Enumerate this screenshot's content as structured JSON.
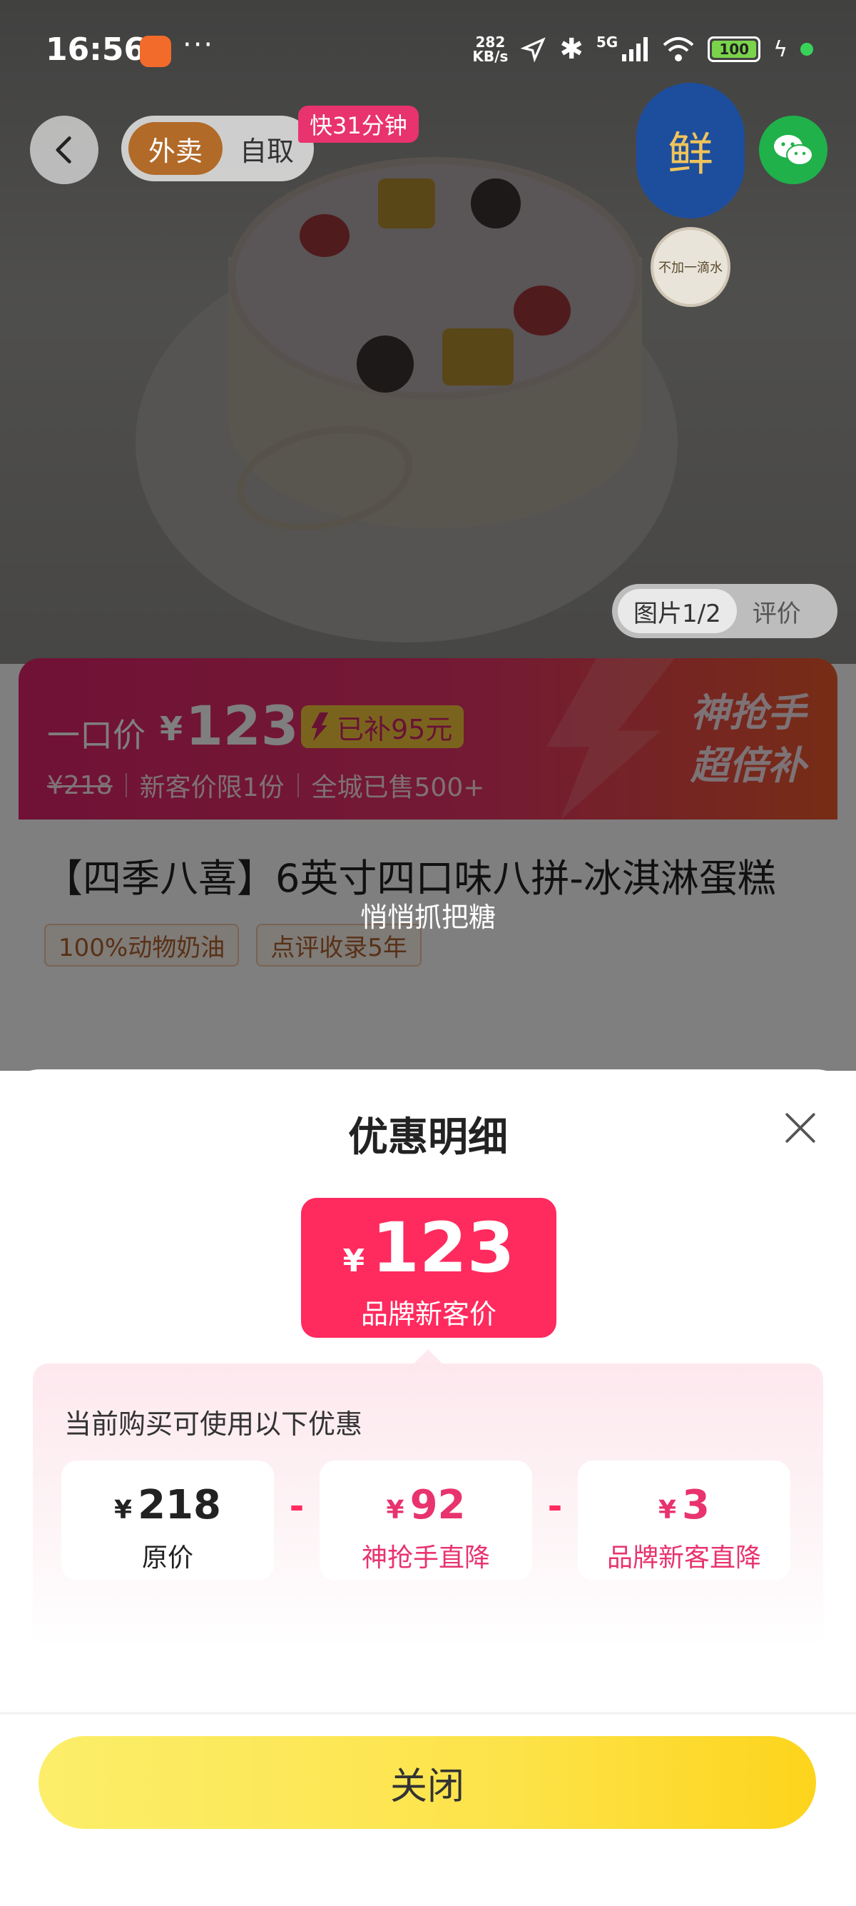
{
  "status_bar": {
    "time": "16:56",
    "more": "···",
    "net_speed_value": "282",
    "net_speed_unit": "KB/s",
    "signal_label": "5G",
    "battery": "100",
    "icons": [
      "navigation-icon",
      "bluetooth-icon",
      "signal-icon",
      "wifi-icon",
      "charging-icon"
    ]
  },
  "nav": {
    "mode_active": "外卖",
    "mode_inactive": "自取",
    "fast_badge": "快31分钟"
  },
  "hero": {
    "fresh_badge": "鲜",
    "no_water_badge": "不加一滴水",
    "image_tab_active": "图片1/2",
    "image_tab_review": "评价"
  },
  "price_banner": {
    "label": "一口价",
    "yen": "¥",
    "price": "123",
    "subsidy": "已补95元",
    "original_price": "¥218",
    "new_customer": "新客价限1份",
    "sold": "全城已售500+",
    "promo_line1": "神抢手",
    "promo_line2": "超倍补"
  },
  "product": {
    "title": "【四季八喜】6英寸四口味八拼-冰淇淋蛋糕",
    "tags": [
      "100%动物奶油",
      "点评收录5年"
    ]
  },
  "toast": "悄悄抓把糖",
  "sheet": {
    "title": "优惠明细",
    "final_price": {
      "yen": "¥",
      "value": "123",
      "label": "品牌新客价"
    },
    "discount_title": "当前购买可使用以下优惠",
    "items": [
      {
        "yen": "¥",
        "value": "218",
        "label": "原价"
      },
      {
        "yen": "¥",
        "value": "92",
        "label": "神抢手直降"
      },
      {
        "yen": "¥",
        "value": "3",
        "label": "品牌新客直降"
      }
    ],
    "minus": "-",
    "close_button": "关闭"
  },
  "colors": {
    "accent_pink": "#ff2a5e",
    "button_yellow": "#fde34a",
    "mode_brown": "#b26a28",
    "wechat_green": "#20b14a"
  }
}
